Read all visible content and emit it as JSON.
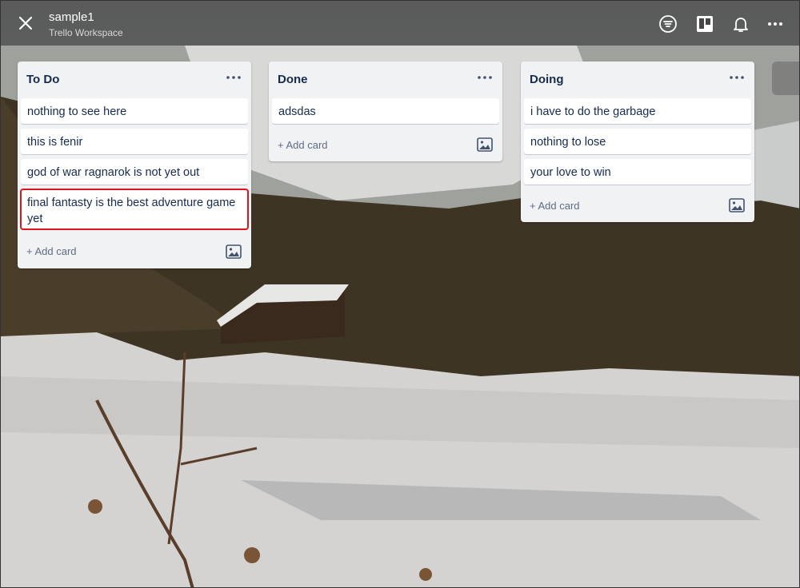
{
  "header": {
    "board_title": "sample1",
    "workspace": "Trello Workspace",
    "icons": [
      "close-icon",
      "filter-icon",
      "board-view-icon",
      "bell-icon",
      "more-icon"
    ]
  },
  "lists": [
    {
      "title": "To Do",
      "cards": [
        "nothing to see here",
        "this is fenir",
        "god of war ragnarok is not yet out",
        "final fantasty is the best adventure game yet"
      ],
      "add_card": "+ Add card"
    },
    {
      "title": "Done",
      "cards": [
        "adsdas"
      ],
      "add_card": "+ Add card"
    },
    {
      "title": "Doing",
      "cards": [
        "i have to do the garbage",
        "nothing to lose",
        "your love to win"
      ],
      "add_card": "+ Add card"
    }
  ],
  "colors": {
    "header_bg": "#464646",
    "list_bg": "#f1f2f4",
    "selection_outline": "#e0141b"
  }
}
